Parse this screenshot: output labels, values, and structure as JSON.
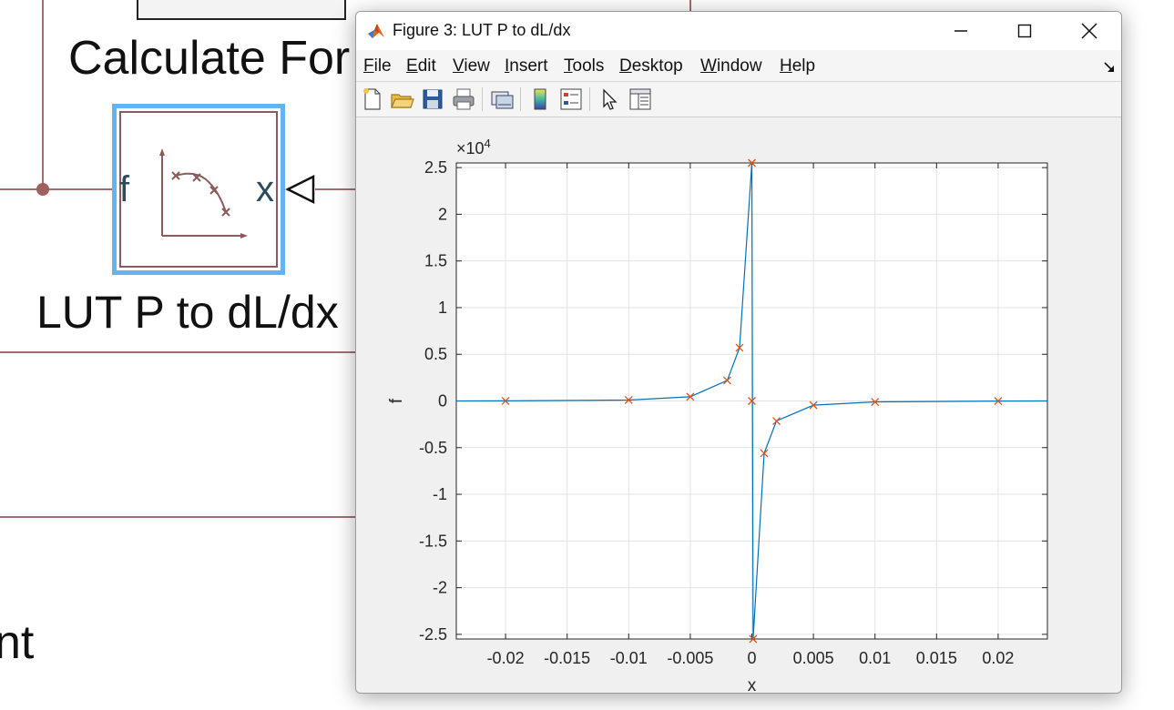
{
  "background_model": {
    "subsystem_label": "Calculate For",
    "lut_block_name": "LUT P to dL/dx",
    "lut_input_port": "x",
    "lut_output_port": "f",
    "partial_label_bottom": "nt"
  },
  "figure": {
    "title": "Figure 3: LUT P to dL/dx",
    "menu": [
      {
        "label": "File",
        "ul": "F",
        "rest": "ile"
      },
      {
        "label": "Edit",
        "ul": "E",
        "rest": "dit"
      },
      {
        "label": "View",
        "ul": "V",
        "rest": "iew"
      },
      {
        "label": "Insert",
        "ul": "I",
        "rest": "nsert"
      },
      {
        "label": "Tools",
        "ul": "T",
        "rest": "ools"
      },
      {
        "label": "Desktop",
        "ul": "D",
        "rest": "esktop"
      },
      {
        "label": "Window",
        "ul": "W",
        "rest": "indow"
      },
      {
        "label": "Help",
        "ul": "H",
        "rest": "elp"
      }
    ],
    "toolbar_icons": [
      "new-figure-icon",
      "open-file-icon",
      "save-icon",
      "print-icon",
      "link-plot-icon",
      "colorbar-icon",
      "legend-icon",
      "edit-plot-icon",
      "property-inspector-icon"
    ]
  },
  "chart_data": {
    "type": "line",
    "title": "",
    "xlabel": "x",
    "ylabel": "f",
    "exponent_label": "×10",
    "exponent_power": "4",
    "xlim": [
      -0.024,
      0.024
    ],
    "ylim": [
      -25500,
      25500
    ],
    "xticks": [
      -0.02,
      -0.015,
      -0.01,
      -0.005,
      0,
      0.005,
      0.01,
      0.015,
      0.02
    ],
    "xtick_labels": [
      "-0.02",
      "-0.015",
      "-0.01",
      "-0.005",
      "0",
      "0.005",
      "0.01",
      "0.015",
      "0.02"
    ],
    "yticks": [
      -25000,
      -20000,
      -15000,
      -10000,
      -5000,
      0,
      5000,
      10000,
      15000,
      20000,
      25000
    ],
    "ytick_labels": [
      "-2.5",
      "-2",
      "-1.5",
      "-1",
      "-0.5",
      "0",
      "0.5",
      "1",
      "1.5",
      "2",
      "2.5"
    ],
    "grid": true,
    "line_color": "#0072bd",
    "marker_color": "#d95319",
    "line_x": [
      -0.024,
      -0.02,
      -0.01,
      -0.005,
      -0.002,
      -0.001,
      0,
      0.0001,
      0.001,
      0.002,
      0.005,
      0.01,
      0.02,
      0.024
    ],
    "line_y": [
      0,
      10,
      100,
      450,
      2200,
      5700,
      25600,
      -25700,
      -5600,
      -2150,
      -450,
      -100,
      -10,
      0
    ],
    "marker_x": [
      -0.02,
      -0.01,
      -0.005,
      -0.002,
      -0.001,
      0,
      0,
      0.0001,
      0.001,
      0.002,
      0.005,
      0.01,
      0.02
    ],
    "marker_y": [
      10,
      100,
      450,
      2200,
      5700,
      25600,
      0,
      -25700,
      -5600,
      -2150,
      -450,
      -100,
      -10
    ]
  }
}
